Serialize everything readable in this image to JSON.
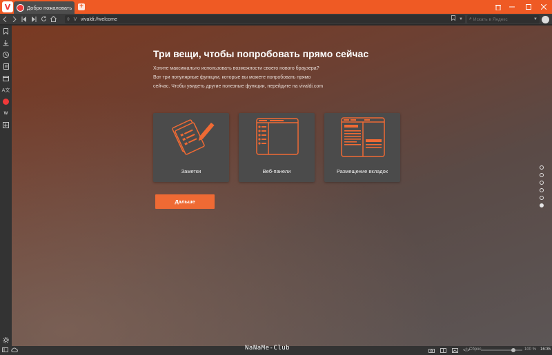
{
  "tab": {
    "title": "Добро пожаловать",
    "new_tab_symbol": "+"
  },
  "address": {
    "url": "vivaldi://welcome",
    "search_placeholder": "Искать в Яндекс"
  },
  "welcome": {
    "heading": "Три вещи, чтобы попробовать прямо сейчас",
    "description": "Хотите максимально использовать возможности своего нового браузера? Вот три популярные функции, которые вы можете попробовать прямо сейчас. Чтобы увидеть другие полезные функции, перейдите на vivaldi.com",
    "cards": [
      {
        "label": "Заметки",
        "icon": "notes-icon"
      },
      {
        "label": "Веб-панели",
        "icon": "web-panels-icon"
      },
      {
        "label": "Размещение вкладок",
        "icon": "tab-tiling-icon"
      }
    ],
    "next_button": "Дальше",
    "pagination": {
      "total": 6,
      "active": 6
    }
  },
  "statusbar": {
    "reset_label": "Сброс",
    "zoom": "100 %",
    "time": "16:35"
  },
  "watermark": "NaNaMe-Club",
  "colors": {
    "accent": "#ef5a24",
    "card_bg": "#4b4b4b",
    "button": "#ef6a34"
  }
}
